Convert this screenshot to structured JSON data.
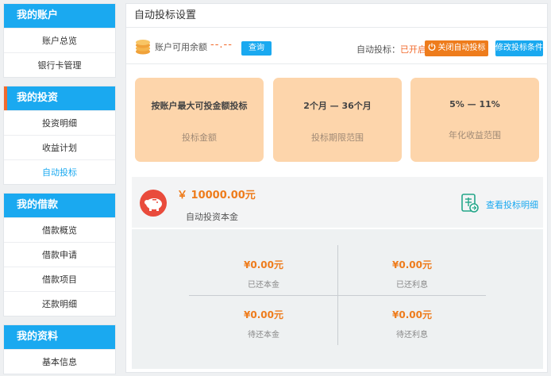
{
  "sidebar": {
    "groups": [
      {
        "title": "我的账户",
        "items": [
          "账户总览",
          "银行卡管理"
        ]
      },
      {
        "title": "我的投资",
        "items": [
          "投资明细",
          "收益计划",
          "自动投标"
        ]
      },
      {
        "title": "我的借款",
        "items": [
          "借款概览",
          "借款申请",
          "借款项目",
          "还款明细"
        ]
      },
      {
        "title": "我的资料",
        "items": [
          "基本信息"
        ]
      }
    ]
  },
  "main": {
    "title": "自动投标设置",
    "balance_label": "账户可用余额",
    "balance_value": "--.--",
    "query_button": "查询",
    "auto_bid_label": "自动投标：",
    "auto_bid_status": "已开启",
    "close_auto_button": "关闭自动投标",
    "modify_button": "修改投标条件",
    "cards": [
      {
        "value": "按账户最大可投金额投标",
        "label": "投标金额"
      },
      {
        "value": "2个月 — 36个月",
        "label": "投标期限范围"
      },
      {
        "value": "5% — 11%",
        "label": "年化收益范围"
      }
    ],
    "summary": {
      "amount": "￥ 10000.00元",
      "amount_label": "自动投资本金",
      "detail_link": "查看投标明细"
    },
    "stats": [
      {
        "value": "¥0.00元",
        "label": "已还本金"
      },
      {
        "value": "¥0.00元",
        "label": "已还利息"
      },
      {
        "value": "¥0.00元",
        "label": "待还本金"
      },
      {
        "value": "¥0.00元",
        "label": "待还利息"
      }
    ]
  },
  "colors": {
    "accent_blue": "#1aa9f0",
    "accent_orange": "#ee7c1c",
    "card_bg": "#fdd5ab",
    "pig_red": "#e94b3c",
    "detail_green": "#25a78a"
  }
}
